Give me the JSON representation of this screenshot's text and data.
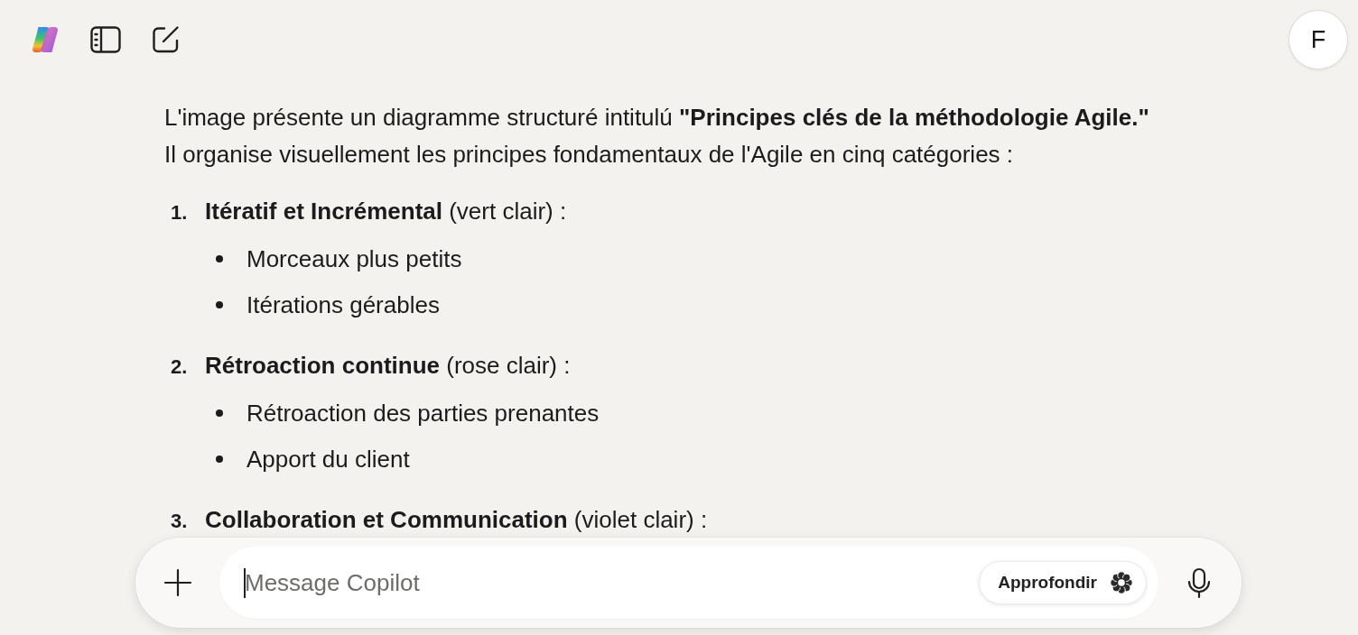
{
  "header": {
    "avatar": "F"
  },
  "message": {
    "intro_lines": [
      "L'image présente un diagramme structuré intitulú **\"Principes clés de la méthodologie Agile.\"**",
      "Il organise visuellement les principes fondamentaux de l'Agile en cinq catégories :"
    ],
    "sections": [
      {
        "number": "1.",
        "heading": "**Itératif et Incrémental** (vert clair) :",
        "bullets": [
          "Morceaux plus petits",
          "Itérations gérables"
        ]
      },
      {
        "number": "2.",
        "heading": "**Rétroaction continue** (rose clair) :",
        "bullets": [
          "Rétroaction des parties prenantes",
          "Apport du client"
        ]
      },
      {
        "number": "3.",
        "heading": "**Collaboration et Communication** (violet clair) :"
      }
    ]
  },
  "composer": {
    "placeholder": "Message Copilot",
    "focused": true,
    "deep_button": "Approfondir"
  }
}
